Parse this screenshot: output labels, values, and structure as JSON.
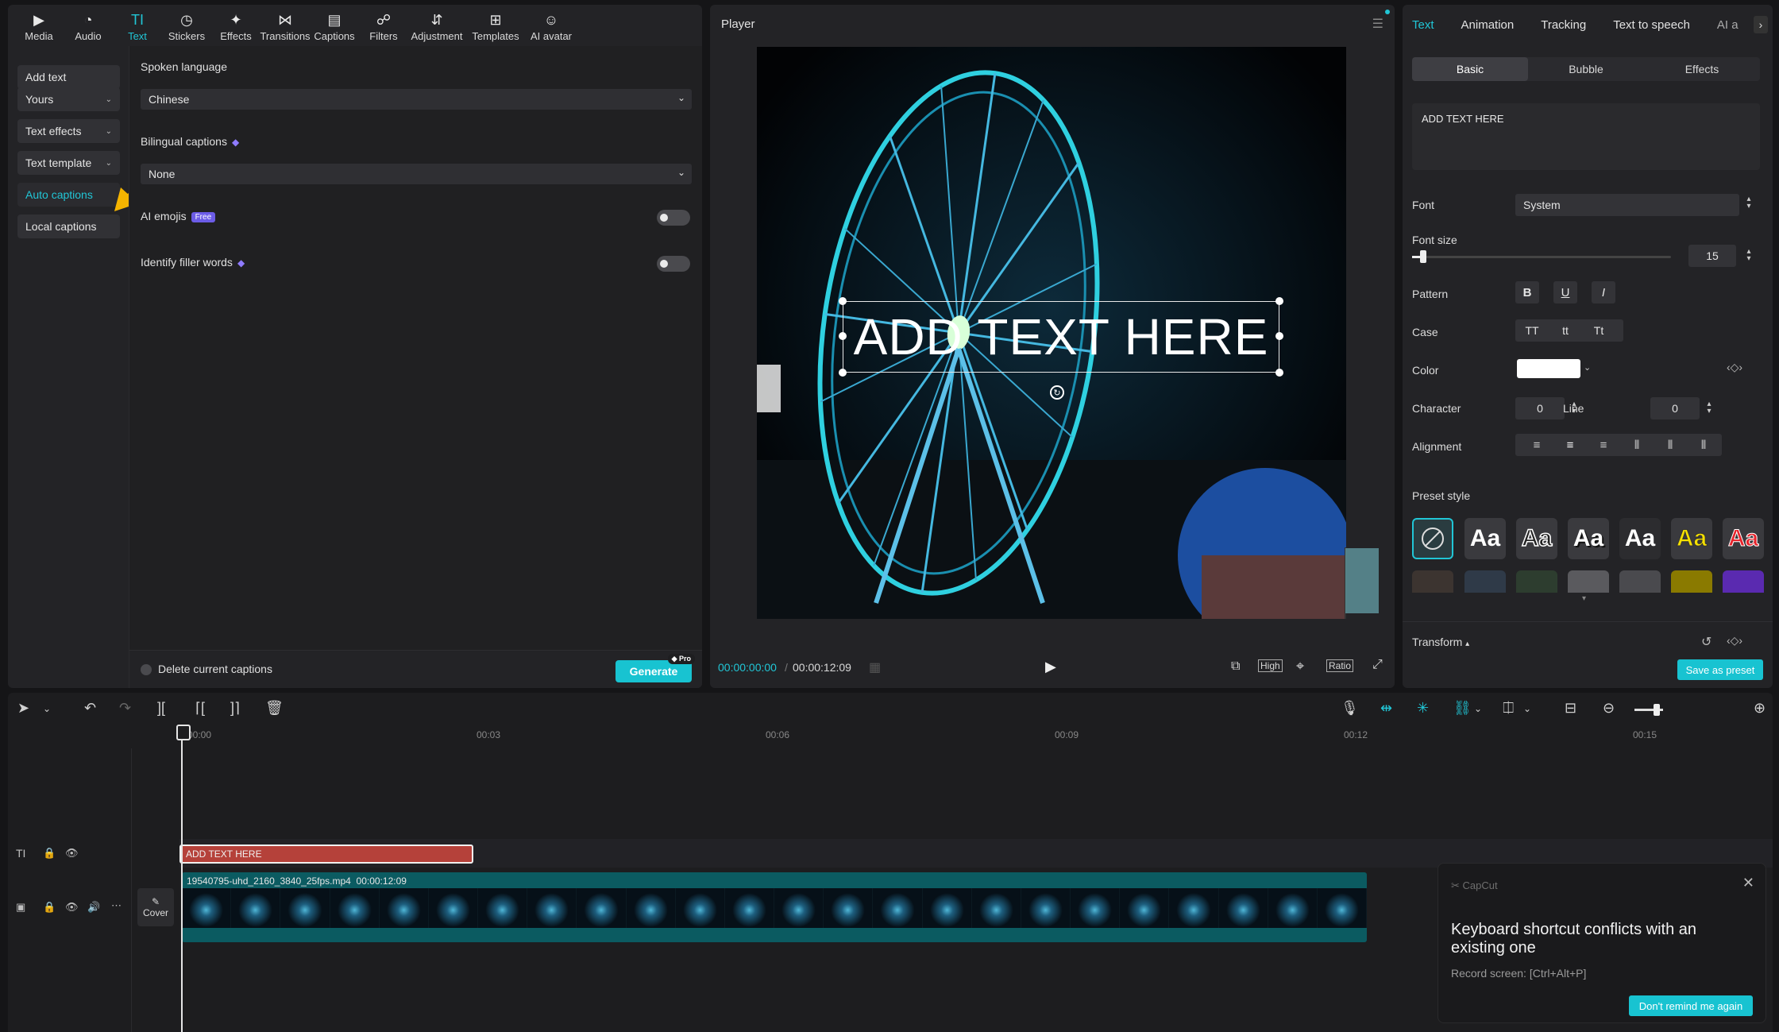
{
  "toolbar": {
    "items": [
      {
        "label": "Media",
        "icon": "media-icon"
      },
      {
        "label": "Audio",
        "icon": "audio-icon"
      },
      {
        "label": "Text",
        "icon": "text-icon"
      },
      {
        "label": "Stickers",
        "icon": "stickers-icon"
      },
      {
        "label": "Effects",
        "icon": "effects-icon"
      },
      {
        "label": "Transitions",
        "icon": "transitions-icon"
      },
      {
        "label": "Captions",
        "icon": "captions-icon"
      },
      {
        "label": "Filters",
        "icon": "filters-icon"
      },
      {
        "label": "Adjustment",
        "icon": "adjustment-icon"
      },
      {
        "label": "Templates",
        "icon": "templates-icon"
      },
      {
        "label": "AI avatar",
        "icon": "ai-avatar-icon"
      }
    ],
    "active": "Text"
  },
  "sidenav": {
    "items": [
      "Add text",
      "Yours",
      "Text effects",
      "Text template",
      "Auto captions",
      "Local captions"
    ],
    "active": "Auto captions"
  },
  "captions": {
    "spoken_language_label": "Spoken language",
    "spoken_language_value": "Chinese",
    "bilingual_label": "Bilingual captions",
    "bilingual_value": "None",
    "ai_emojis_label": "AI emojis",
    "ai_emojis_badge": "Free",
    "filler_label": "Identify filler words",
    "delete_label": "Delete current captions",
    "generate_label": "Generate",
    "pro_badge": "Pro"
  },
  "player": {
    "title": "Player",
    "overlay_text": "ADD TEXT HERE",
    "current_time": "00:00:00:00",
    "total_time": "00:00:12:09",
    "quality": "High",
    "ratio": "Ratio"
  },
  "inspector": {
    "tabs": [
      "Text",
      "Animation",
      "Tracking",
      "Text to speech",
      "AI a"
    ],
    "active_tab": "Text",
    "subtabs": [
      "Basic",
      "Bubble",
      "Effects"
    ],
    "active_subtab": "Basic",
    "text_value": "ADD TEXT HERE",
    "font_label": "Font",
    "font_value": "System",
    "font_size_label": "Font size",
    "font_size_value": "15",
    "pattern_label": "Pattern",
    "pattern_buttons": [
      "B",
      "U",
      "I"
    ],
    "case_label": "Case",
    "case_buttons": [
      "TT",
      "tt",
      "Tt"
    ],
    "color_label": "Color",
    "color_value": "#ffffff",
    "character_label": "Character",
    "character_value": "0",
    "line_label": "Line",
    "line_value": "0",
    "alignment_label": "Alignment",
    "preset_label": "Preset style",
    "preset_sample": "Aa",
    "transform_label": "Transform",
    "save_preset_label": "Save as preset"
  },
  "timeline": {
    "ruler": [
      "00:00",
      "00:03",
      "00:06",
      "00:09",
      "00:12",
      "00:15"
    ],
    "text_clip": "ADD TEXT HERE",
    "video_clip_name": "19540795-uhd_2160_3840_25fps.mp4",
    "video_clip_duration": "00:00:12:09",
    "cover_label": "Cover"
  },
  "notification": {
    "brand": "CapCut",
    "title": "Keyboard shortcut conflicts with an existing one",
    "subtitle": "Record screen: [Ctrl+Alt+P]",
    "button": "Don't remind me again"
  },
  "colors": {
    "accent": "#21c6d6",
    "button": "#18c3d1",
    "text_clip": "#b5413a",
    "video_clip": "#0b5b61",
    "arrow": "#f5b400"
  }
}
